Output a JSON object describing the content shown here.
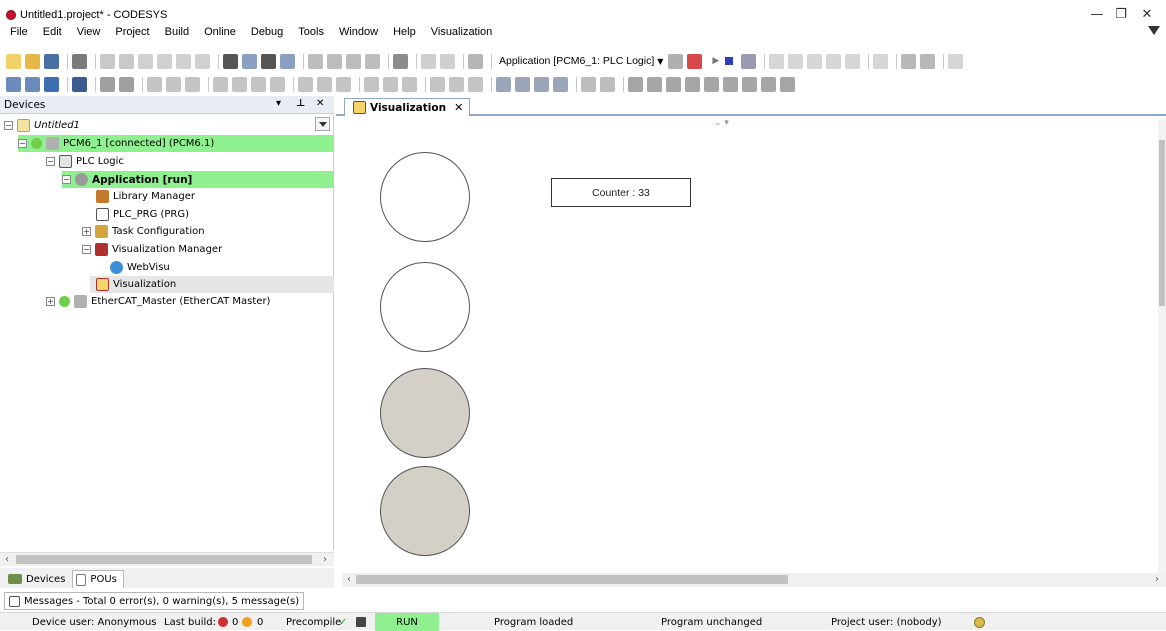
{
  "window": {
    "title": "Untitled1.project* - CODESYS",
    "minimize": "—",
    "maximize": "❐",
    "close": "✕"
  },
  "menu": [
    "File",
    "Edit",
    "View",
    "Project",
    "Build",
    "Online",
    "Debug",
    "Tools",
    "Window",
    "Help",
    "Visualization"
  ],
  "toolbar": {
    "active_application": "Application [PCM6_1: PLC Logic]"
  },
  "devices_pane": {
    "title": "Devices",
    "pin": "▾ ⊥ ✕",
    "tree": [
      {
        "label": "Untitled1",
        "italic": true,
        "icon": "project-icon"
      },
      {
        "label": "PCM6_1 [connected] (PCM6.1)",
        "icon": "device-icon",
        "highlight": true
      },
      {
        "label": "PLC Logic",
        "icon": "plc-logic-icon"
      },
      {
        "label": "Application [run]",
        "icon": "application-icon",
        "highlight": true,
        "bold": true
      },
      {
        "label": "Library Manager",
        "icon": "library-icon"
      },
      {
        "label": "PLC_PRG (PRG)",
        "icon": "program-icon"
      },
      {
        "label": "Task Configuration",
        "icon": "task-config-icon"
      },
      {
        "label": "Visualization Manager",
        "icon": "visu-manager-icon"
      },
      {
        "label": "WebVisu",
        "icon": "webvisu-icon"
      },
      {
        "label": "Visualization",
        "icon": "visualization-icon",
        "selected": true
      },
      {
        "label": "EtherCAT_Master (EtherCAT Master)",
        "icon": "ethercat-icon"
      }
    ],
    "tabs": [
      "Devices",
      "POUs"
    ]
  },
  "editor": {
    "tab_label": "Visualization",
    "counter_text": "Counter : 33",
    "lamps": [
      {
        "state": "off",
        "color": "#ffffff"
      },
      {
        "state": "off",
        "color": "#ffffff"
      },
      {
        "state": "on",
        "color": "#d4d0c8"
      },
      {
        "state": "on",
        "color": "#d4d0c8"
      }
    ]
  },
  "messages": {
    "summary": "Messages - Total 0 error(s), 0 warning(s), 5 message(s)"
  },
  "status": {
    "device_user": "Device user: Anonymous",
    "last_build": "Last build:",
    "errors": "0",
    "warnings": "0",
    "precompile": "Precompile",
    "run": "RUN",
    "program_loaded": "Program loaded",
    "program_unchanged": "Program unchanged",
    "project_user": "Project user: (nobody)"
  },
  "colors": {
    "online_green": "#8ef08e",
    "lamp_on": "#d4d0c8",
    "accent_blue": "#8fa6c8"
  }
}
